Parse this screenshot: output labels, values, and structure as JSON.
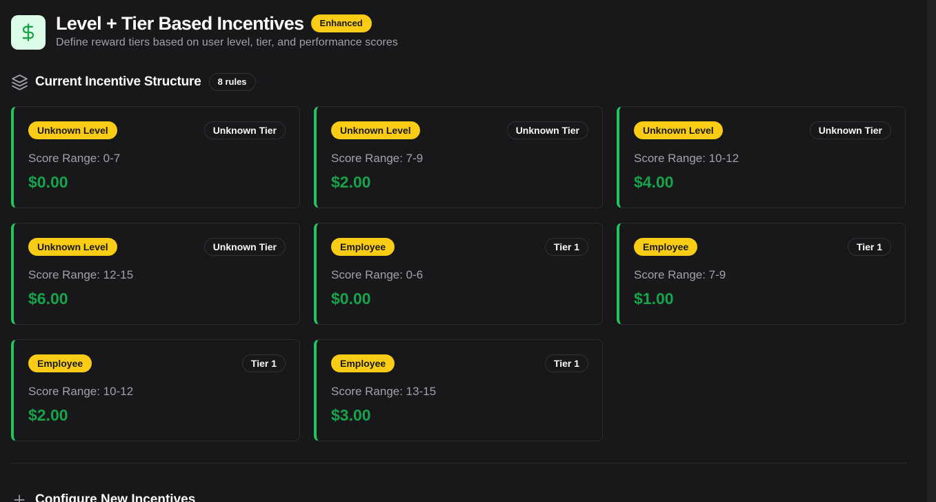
{
  "header": {
    "icon": "dollar-icon",
    "title": "Level + Tier Based Incentives",
    "badge": "Enhanced",
    "subtitle": "Define reward tiers based on user level, tier, and performance scores"
  },
  "structure": {
    "icon": "layers-icon",
    "title": "Current Incentive Structure",
    "count_badge": "8 rules"
  },
  "rules": [
    {
      "level": "Unknown Level",
      "tier": "Unknown Tier",
      "score": "Score Range: 0-7",
      "amount": "$0.00"
    },
    {
      "level": "Unknown Level",
      "tier": "Unknown Tier",
      "score": "Score Range: 7-9",
      "amount": "$2.00"
    },
    {
      "level": "Unknown Level",
      "tier": "Unknown Tier",
      "score": "Score Range: 10-12",
      "amount": "$4.00"
    },
    {
      "level": "Unknown Level",
      "tier": "Unknown Tier",
      "score": "Score Range: 12-15",
      "amount": "$6.00"
    },
    {
      "level": "Employee",
      "tier": "Tier 1",
      "score": "Score Range: 0-6",
      "amount": "$0.00"
    },
    {
      "level": "Employee",
      "tier": "Tier 1",
      "score": "Score Range: 7-9",
      "amount": "$1.00"
    },
    {
      "level": "Employee",
      "tier": "Tier 1",
      "score": "Score Range: 10-12",
      "amount": "$2.00"
    },
    {
      "level": "Employee",
      "tier": "Tier 1",
      "score": "Score Range: 13-15",
      "amount": "$3.00"
    }
  ],
  "configure": {
    "icon": "plus-icon",
    "title": "Configure New Incentives"
  },
  "colors": {
    "background": "#18181b",
    "accent_green": "#22c55e",
    "amount_green": "#16a34a",
    "badge_yellow": "#facc15"
  }
}
